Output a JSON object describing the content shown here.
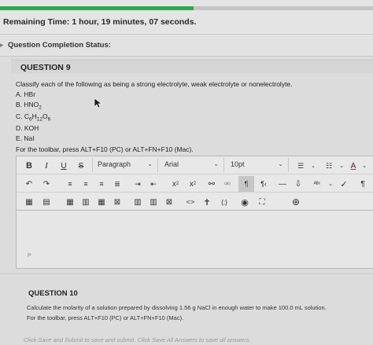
{
  "header": {
    "remaining_time": "Remaining Time: 1 hour, 19 minutes, 07 seconds.",
    "progress_fraction": 0.52,
    "progress_color": "#2fa84f"
  },
  "status": {
    "label": "Question Completion Status:"
  },
  "question9": {
    "title": "QUESTION 9",
    "prompt": "Classify each of the following as being a strong electrolyte, weak electrolyte or nonelectrolyte.",
    "options": [
      {
        "letter": "A.",
        "main": "HBr"
      },
      {
        "letter": "B.",
        "main": "HNO",
        "sub": "2"
      },
      {
        "letter": "C.",
        "main": "C",
        "sub1": "6",
        "mid1": "H",
        "sub2": "12",
        "mid2": "O",
        "sub3": "6"
      },
      {
        "letter": "D.",
        "main": "KOH"
      },
      {
        "letter": "E.",
        "main": "NaI"
      }
    ],
    "toolbar_hint": "For the toolbar, press ALT+F10 (PC) or ALT+FN+F10 (Mac)."
  },
  "toolbar": {
    "bold": "B",
    "italic": "I",
    "underline": "U",
    "strike": "S",
    "paragraph": "Paragraph",
    "font": "Arial",
    "size": "10pt",
    "superscript_x": "x",
    "superscript_mark": "2",
    "subscript_x": "x",
    "subscript_mark": "2",
    "text_color_letter": "A",
    "text_color": "#d12a2a",
    "code_label": "<>",
    "braces_label": "{;}",
    "pilcrow_label": "¶",
    "pilcrow_ltr": "¶",
    "pilcrow_rtl": "¶‹",
    "dash": "—",
    "check": "✓"
  },
  "editor": {
    "p_tag": "P"
  },
  "question10": {
    "title": "QUESTION 10",
    "prompt": "Calculate the molarity of a solution prepared by dissolving 1.56 g NaCl in enough water to make 100.0 mL solution.",
    "toolbar_hint": "For the toolbar, press ALT+F10 (PC) or ALT+FN+F10 (Mac)."
  },
  "footer": {
    "text": "Click Save and Submit to save and submit. Click Save All Answers to save all answers."
  }
}
